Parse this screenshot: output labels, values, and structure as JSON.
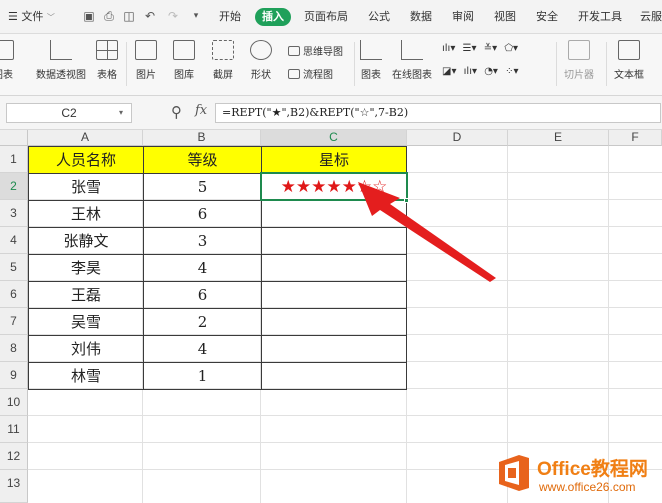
{
  "menubar": {
    "app_menu": "文件",
    "tabs": [
      "开始",
      "插入",
      "页面布局",
      "公式",
      "数据",
      "审阅",
      "视图",
      "安全",
      "开发工具",
      "云服"
    ]
  },
  "ribbon": {
    "buttons": [
      "图表",
      "数据透视图",
      "表格",
      "图片",
      "图库",
      "截屏",
      "形状",
      "图表",
      "在线图表",
      "切片器",
      "文本框"
    ],
    "small": [
      "思维导图",
      "流程图"
    ]
  },
  "formula_bar": {
    "cell_ref": "C2",
    "fx": "fx",
    "formula": "=REPT(\"★\",B2)&REPT(\"☆\",7-B2)"
  },
  "sheet": {
    "columns": [
      "A",
      "B",
      "C",
      "D",
      "E",
      "F"
    ],
    "rows": [
      "1",
      "2",
      "3",
      "4",
      "5",
      "6",
      "7",
      "8",
      "9",
      "10",
      "11",
      "12",
      "13"
    ],
    "headers": [
      "人员名称",
      "等级",
      "星标"
    ],
    "data": [
      {
        "name": "张雪",
        "level": "5",
        "stars": "★★★★★☆☆"
      },
      {
        "name": "王林",
        "level": "6",
        "stars": ""
      },
      {
        "name": "张静文",
        "level": "3",
        "stars": ""
      },
      {
        "name": "李昊",
        "level": "4",
        "stars": ""
      },
      {
        "name": "王磊",
        "level": "6",
        "stars": ""
      },
      {
        "name": "吴雪",
        "level": "2",
        "stars": ""
      },
      {
        "name": "刘伟",
        "level": "4",
        "stars": ""
      },
      {
        "name": "林雪",
        "level": "1",
        "stars": ""
      }
    ]
  },
  "watermark": {
    "brand": "Office教程网",
    "url": "www.office26.com"
  },
  "colors": {
    "header_fill": "#ffff00",
    "star_color": "#e01818",
    "selection_green": "#1e8a4e",
    "arrow_red": "#e41e1e",
    "brand_orange": "#f07f14"
  }
}
